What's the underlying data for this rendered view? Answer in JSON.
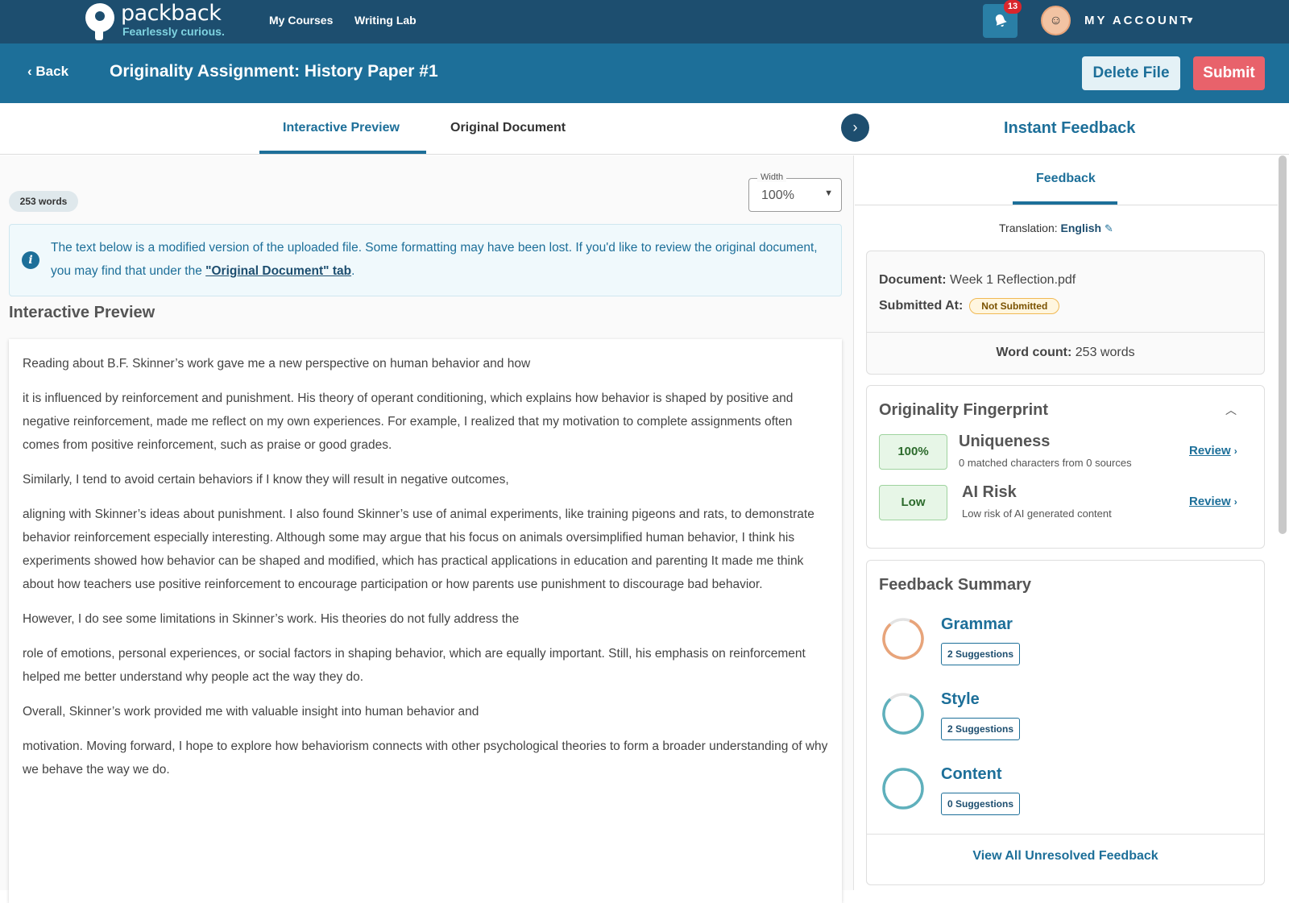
{
  "nav": {
    "logo_name": "packback",
    "logo_tagline": "Fearlessly curious.",
    "links": [
      "My Courses",
      "Writing Lab"
    ],
    "notification_count": "13",
    "account_label": "MY ACCOUNT"
  },
  "header": {
    "back_label": "Back",
    "title": "Originality Assignment: History Paper #1",
    "delete_label": "Delete File",
    "submit_label": "Submit"
  },
  "tabs": {
    "interactive": "Interactive Preview",
    "original": "Original Document",
    "panel_title": "Instant Feedback"
  },
  "preview": {
    "word_count_pill": "253 words",
    "width_label": "Width",
    "width_value": "100%",
    "info_text_before": "The text below is a modified version of the uploaded file. Some formatting may have been lost. If you'd like to review the original document, you may find that under the ",
    "info_link": "\"Original Document\" tab",
    "info_text_after": ".",
    "heading": "Interactive Preview",
    "paragraphs": [
      "Reading about B.F. Skinner’s work gave me a new perspective on human behavior and how",
      "it is influenced by reinforcement and punishment. His theory of operant conditioning, which explains how behavior is shaped by positive and negative reinforcement, made me reflect on my own experiences. For example, I realized that my motivation to complete assignments often comes from positive reinforcement, such as praise or good grades.",
      "Similarly, I tend to avoid certain behaviors if I know they will result in negative outcomes,",
      "aligning with Skinner’s ideas about punishment. I also found Skinner’s use of animal experiments, like training pigeons and rats, to demonstrate behavior reinforcement especially interesting. Although some may argue that his focus on animals oversimplified human behavior, I think his experiments showed how behavior can be shaped and modified, which has practical applications in education and parenting It made me think about how teachers use positive reinforcement to encourage participation or how parents use punishment to discourage bad behavior.",
      "However, I do see some limitations in Skinner’s work. His theories do not fully address the",
      "role of emotions, personal experiences, or social factors in shaping behavior, which are equally important. Still, his emphasis on reinforcement helped me better understand why people act the way they do.",
      "Overall, Skinner’s work provided me with valuable insight into human behavior and",
      "motivation. Moving forward, I hope to explore how behaviorism connects with other psychological theories to form a broader understanding of why we behave the way we do."
    ]
  },
  "feedback": {
    "subtab": "Feedback",
    "translation_label": "Translation:",
    "translation_value": "English",
    "document_label": "Document:",
    "document_value": "Week 1 Reflection.pdf",
    "submitted_label": "Submitted At:",
    "submitted_value": "Not Submitted",
    "wordcount_label": "Word count:",
    "wordcount_value": "253 words",
    "fingerprint": {
      "title": "Originality Fingerprint",
      "uniqueness_score": "100%",
      "uniqueness_name": "Uniqueness",
      "uniqueness_sub": "0 matched characters from 0 sources",
      "ai_score": "Low",
      "ai_name": "AI Risk",
      "ai_sub": "Low risk of AI generated content",
      "review_label": "Review"
    },
    "summary": {
      "title": "Feedback Summary",
      "items": [
        {
          "name": "Grammar",
          "suggestions": "2 Suggestions",
          "color": "#e8a47a"
        },
        {
          "name": "Style",
          "suggestions": "2 Suggestions",
          "color": "#5fb0bc"
        },
        {
          "name": "Content",
          "suggestions": "0 Suggestions",
          "color": "#5fb0bc"
        }
      ],
      "view_all": "View All Unresolved Feedback"
    }
  }
}
